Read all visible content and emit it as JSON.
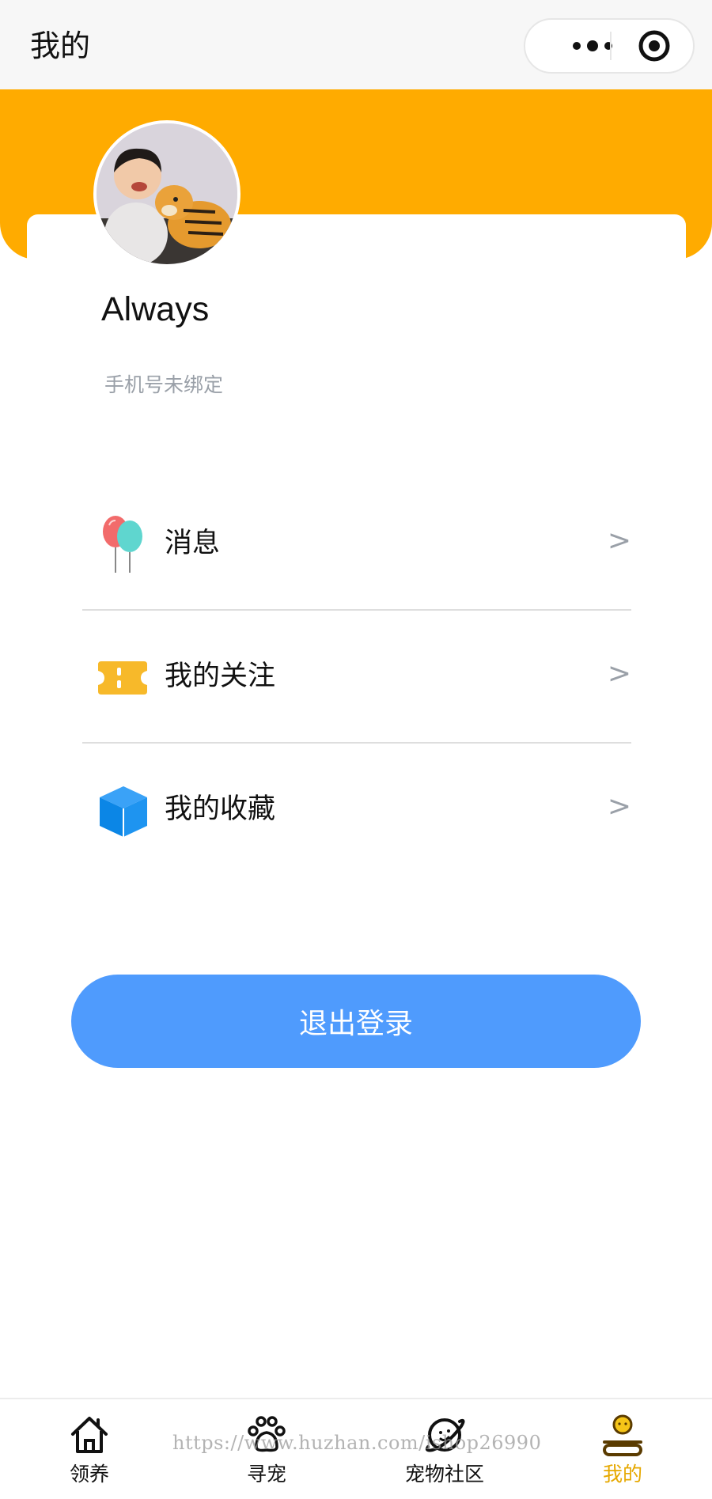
{
  "navbar": {
    "title": "我的",
    "more_icon": "more-dots-icon",
    "close_icon": "target-close-icon"
  },
  "profile": {
    "name": "Always",
    "phone_status": "手机号未绑定",
    "avatar_icon": "avatar-photo"
  },
  "menu": {
    "items": [
      {
        "label": "消息",
        "icon": "balloons-icon",
        "arrow": ">"
      },
      {
        "label": "我的关注",
        "icon": "ticket-icon",
        "arrow": ">"
      },
      {
        "label": "我的收藏",
        "icon": "cube-icon",
        "arrow": ">"
      }
    ]
  },
  "logout_label": "退出登录",
  "tabbar": {
    "items": [
      {
        "label": "领养",
        "icon": "home-icon"
      },
      {
        "label": "寻宠",
        "icon": "paw-icon"
      },
      {
        "label": "宠物社区",
        "icon": "planet-icon"
      },
      {
        "label": "我的",
        "icon": "profile-icon",
        "active": true
      }
    ]
  },
  "watermark": "https://www.huzhan.com/ishop26990",
  "colors": {
    "brand_orange": "#ffab00",
    "button_blue": "#4f9bfd",
    "active_tab": "#e6a800",
    "muted_text": "#9aa0a8"
  }
}
